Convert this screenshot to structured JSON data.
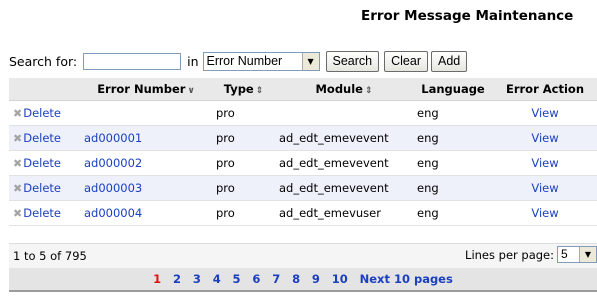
{
  "page": {
    "title": "Error Message Maintenance"
  },
  "search": {
    "label": "Search for:",
    "value": "",
    "in_label": "in",
    "field_selected": "Error Number",
    "search_button": "Search",
    "clear_button": "Clear",
    "add_button": "Add"
  },
  "table": {
    "headers": [
      "",
      "Error Number",
      "Type",
      "Module",
      "Language",
      "Error Action"
    ],
    "delete_label": "Delete",
    "view_label": "View",
    "rows": [
      {
        "error_number": "",
        "type": "pro",
        "module": "",
        "language": "eng"
      },
      {
        "error_number": "ad000001",
        "type": "pro",
        "module": "ad_edt_emevevent",
        "language": "eng"
      },
      {
        "error_number": "ad000002",
        "type": "pro",
        "module": "ad_edt_emevevent",
        "language": "eng"
      },
      {
        "error_number": "ad000003",
        "type": "pro",
        "module": "ad_edt_emevevent",
        "language": "eng"
      },
      {
        "error_number": "ad000004",
        "type": "pro",
        "module": "ad_edt_emevuser",
        "language": "eng"
      }
    ]
  },
  "footer": {
    "count_text": "1 to 5 of 795",
    "lines_label": "Lines per page:",
    "lines_value": "5"
  },
  "pager": {
    "pages": [
      "1",
      "2",
      "3",
      "4",
      "5",
      "6",
      "7",
      "8",
      "9",
      "10"
    ],
    "current": "1",
    "next_label": "Next 10 pages"
  },
  "colors": {
    "link": "#1a3fbf",
    "current_page": "#e01010",
    "header_bg": "#e9e9e9",
    "alt_row_bg": "#eef0fa"
  },
  "icons": {
    "delete": "x-icon",
    "sort_desc": "chevron-down-icon",
    "sort_both": "sort-icon",
    "dropdown": "dropdown-arrow-icon"
  }
}
